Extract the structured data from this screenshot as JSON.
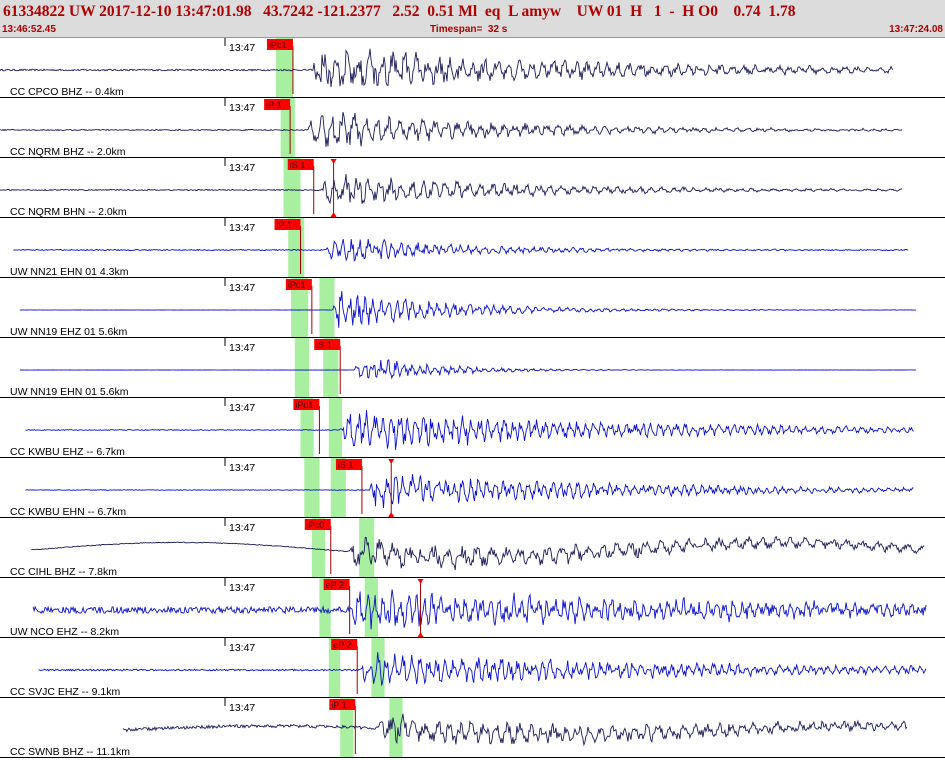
{
  "header": {
    "summary": "61334822 UW 2017-12-10 13:47:01.98   43.7242 -121.2377   2.52  0.51 Ml  eq  L amyw    UW 01  H   1  -  H O0    0.74  1.78",
    "start_time": "13:46:52.45",
    "timespan": "Timespan=  32 s",
    "end_time": "13:47:24.08"
  },
  "colors": {
    "short_period": "#1c1c5a",
    "strong_motion": "#0b12c8",
    "pick_flag": "#ff0000",
    "pick_line": "#a00000",
    "window": "#a8f0a0"
  },
  "time_label": "13:47",
  "channels": [
    {
      "label": "CC CPCO BHZ -- 0.4km",
      "type": "short_period",
      "start": 0.0,
      "end": 0.945,
      "onset": 0.33,
      "amp": 0.85,
      "decay": 0.28,
      "noise": 0.03,
      "freq": 1.0,
      "windows": [
        0.292,
        0.31
      ],
      "picks": [
        {
          "label": "iPc1",
          "pos": 0.31
        }
      ],
      "markers": []
    },
    {
      "label": "CC NQRM BHZ -- 2.0km",
      "type": "short_period",
      "start": 0.0,
      "end": 0.955,
      "onset": 0.325,
      "amp": 0.7,
      "decay": 0.2,
      "noise": 0.02,
      "freq": 1.0,
      "windows": [
        0.297,
        0.312
      ],
      "picks": [
        {
          "label": "iP 1",
          "pos": 0.307
        }
      ],
      "markers": []
    },
    {
      "label": "CC NQRM BHN -- 2.0km",
      "type": "short_period",
      "start": 0.0,
      "end": 0.955,
      "onset": 0.34,
      "amp": 0.6,
      "decay": 0.2,
      "noise": 0.02,
      "freq": 1.0,
      "windows": [
        0.3,
        0.318
      ],
      "picks": [
        {
          "label": "iS 1",
          "pos": 0.332
        }
      ],
      "markers": [
        0.353
      ]
    },
    {
      "label": "UW NN21 EHN 01 4.3km",
      "type": "strong_motion",
      "start": 0.014,
      "end": 0.962,
      "onset": 0.345,
      "amp": 0.5,
      "decay": 0.14,
      "noise": 0.02,
      "freq": 1.4,
      "windows": [
        0.305,
        0.322
      ],
      "picks": [
        {
          "label": "iP 1",
          "pos": 0.318
        }
      ],
      "markers": []
    },
    {
      "label": "UW NN19 EHZ 01 5.6km",
      "type": "strong_motion",
      "start": 0.021,
      "end": 0.97,
      "onset": 0.352,
      "amp": 0.72,
      "decay": 0.12,
      "noise": 0.005,
      "freq": 1.4,
      "windows": [
        0.308,
        0.326,
        0.338,
        0.354
      ],
      "picks": [
        {
          "label": "iPc1",
          "pos": 0.33
        }
      ],
      "markers": []
    },
    {
      "label": "UW NN19 EHN 01 5.6km",
      "type": "strong_motion",
      "start": 0.021,
      "end": 0.97,
      "onset": 0.375,
      "amp": 0.55,
      "decay": 0.08,
      "noise": 0.004,
      "freq": 1.4,
      "windows": [
        0.312,
        0.327,
        0.342,
        0.358
      ],
      "picks": [
        {
          "label": "iS 1",
          "pos": 0.36
        }
      ],
      "markers": []
    },
    {
      "label": "CC KWBU EHZ -- 6.7km",
      "type": "strong_motion",
      "start": 0.027,
      "end": 0.967,
      "onset": 0.36,
      "amp": 0.75,
      "decay": 0.3,
      "noise": 0.015,
      "freq": 1.4,
      "windows": [
        0.318,
        0.332,
        0.348,
        0.362
      ],
      "picks": [
        {
          "label": "iPd1",
          "pos": 0.338
        }
      ],
      "markers": []
    },
    {
      "label": "CC KWBU EHN -- 6.7km",
      "type": "strong_motion",
      "start": 0.027,
      "end": 0.967,
      "onset": 0.39,
      "amp": 0.6,
      "decay": 0.28,
      "noise": 0.012,
      "freq": 1.4,
      "windows": [
        0.322,
        0.338,
        0.35,
        0.366
      ],
      "picks": [
        {
          "label": "iS 1",
          "pos": 0.383
        }
      ],
      "markers": [
        0.414
      ]
    },
    {
      "label": "CC CIHL BHZ -- 7.8km",
      "type": "short_period",
      "start": 0.033,
      "end": 0.978,
      "onset": 0.368,
      "amp": 0.5,
      "decay": 0.5,
      "noise": 0.015,
      "freq": 0.8,
      "drift": 0.28,
      "windows": [
        0.33,
        0.344,
        0.38,
        0.396
      ],
      "picks": [
        {
          "label": "iPc0",
          "pos": 0.35
        }
      ],
      "markers": []
    },
    {
      "label": "UW NCO EHZ -- 8.2km",
      "type": "strong_motion",
      "start": 0.035,
      "end": 0.98,
      "onset": 0.37,
      "amp": 0.65,
      "decay": 0.5,
      "noise": 0.12,
      "freq": 1.4,
      "windows": [
        0.338,
        0.35,
        0.386,
        0.4
      ],
      "picks": [
        {
          "label": "eP 2",
          "pos": 0.37
        }
      ],
      "markers": [
        0.445
      ]
    },
    {
      "label": "CC SVJC EHZ -- 9.1km",
      "type": "strong_motion",
      "start": 0.041,
      "end": 0.98,
      "onset": 0.38,
      "amp": 0.6,
      "decay": 0.38,
      "noise": 0.03,
      "freq": 1.4,
      "windows": [
        0.348,
        0.36,
        0.393,
        0.407
      ],
      "picks": [
        {
          "label": "eP 2",
          "pos": 0.378
        }
      ],
      "markers": []
    },
    {
      "label": "CC SWNB BHZ -- 11.1km",
      "type": "short_period",
      "start": 0.13,
      "end": 0.96,
      "onset": 0.4,
      "amp": 0.55,
      "decay": 0.42,
      "noise": 0.06,
      "freq": 1.0,
      "drift": 0.15,
      "windows": [
        0.36,
        0.374,
        0.412,
        0.426
      ],
      "picks": [
        {
          "label": "iP 1",
          "pos": 0.376
        }
      ],
      "markers": []
    }
  ]
}
